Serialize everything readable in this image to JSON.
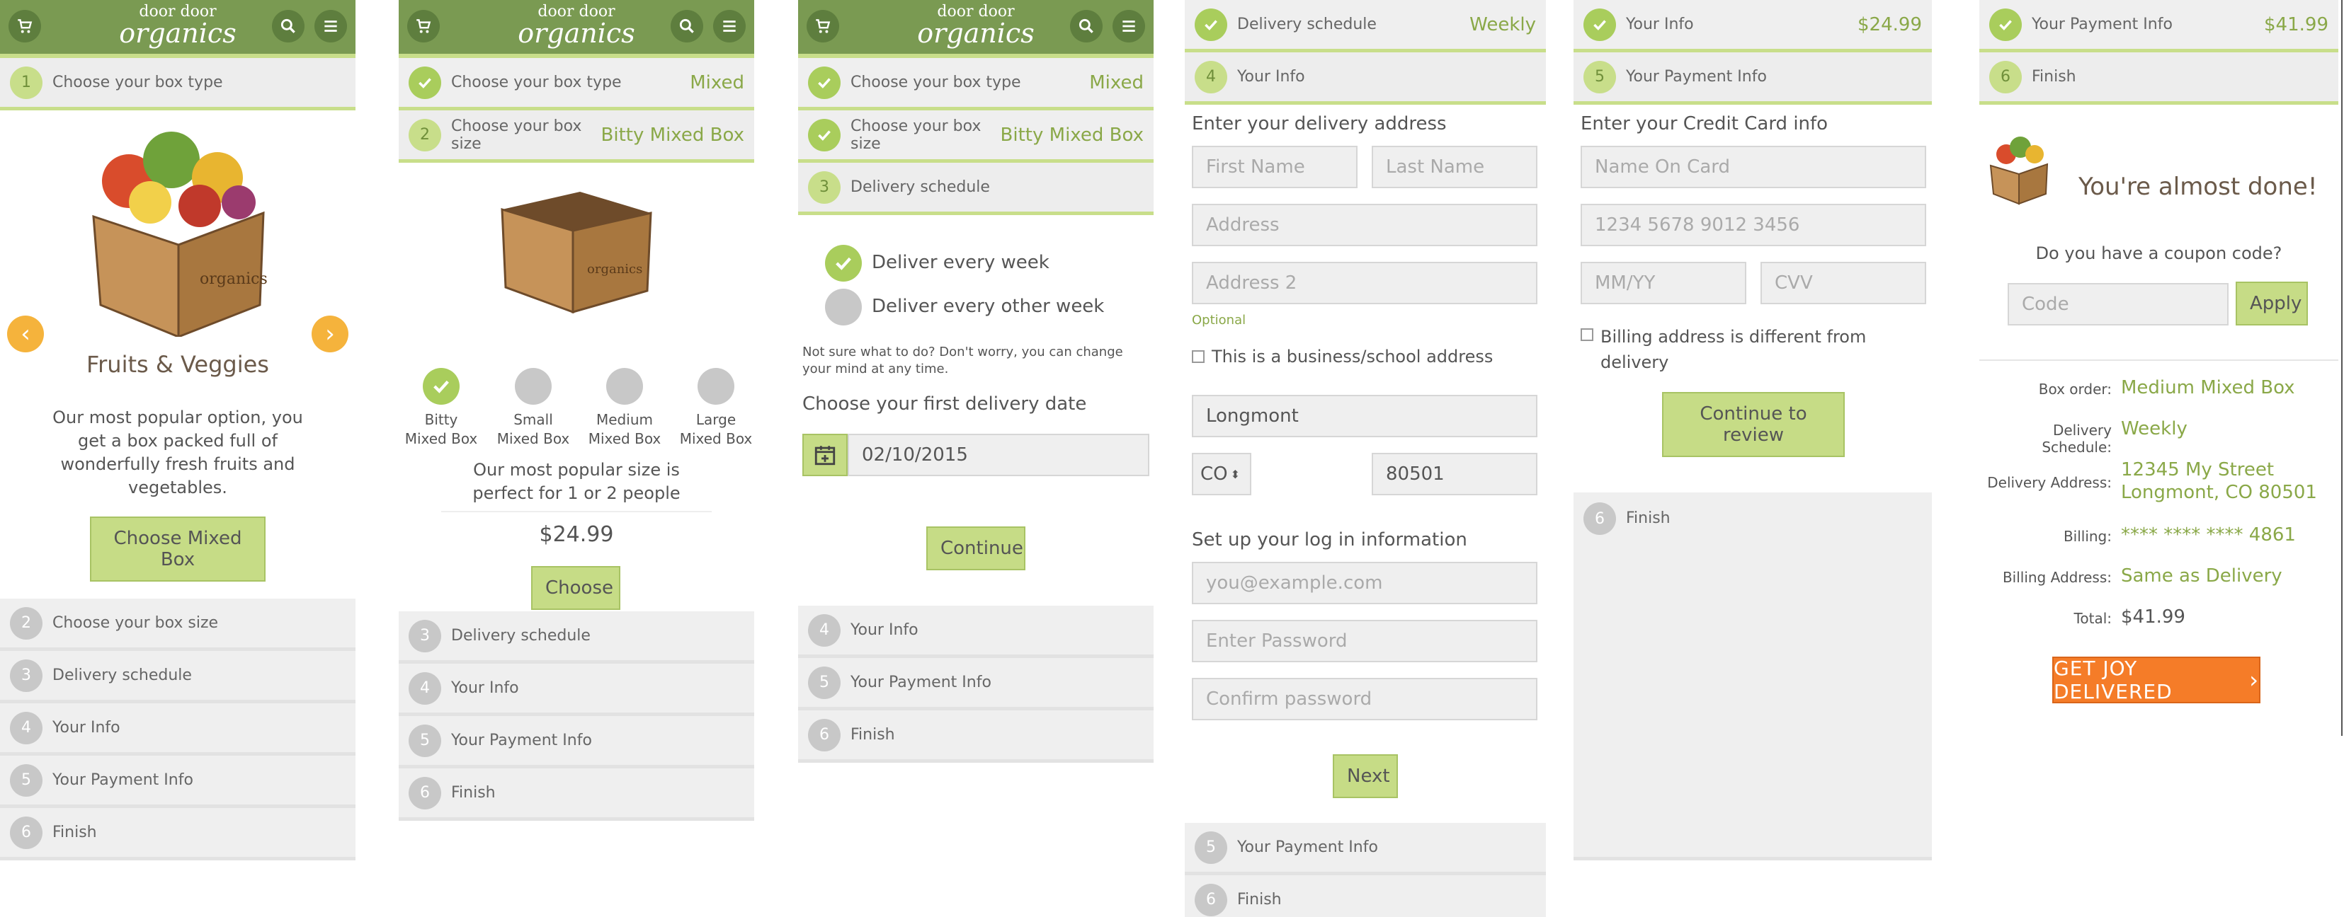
{
  "brand": {
    "line1": "door  door",
    "line2": "organics"
  },
  "colors": {
    "header": "#7a9a52",
    "accent": "#a9cd5c",
    "button": "#c6dc86",
    "orange": "#f57c28"
  },
  "steps": {
    "box_type": "Choose your box type",
    "box_size": "Choose your box size",
    "delivery": "Delivery schedule",
    "info": "Your Info",
    "payment": "Your Payment Info",
    "finish": "Finish"
  },
  "nums": {
    "n1": "1",
    "n2": "2",
    "n3": "3",
    "n4": "4",
    "n5": "5",
    "n6": "6"
  },
  "p1": {
    "title": "Fruits & Veggies",
    "desc": "Our most popular option, you get a box packed full of wonderfully fresh fruits and vegetables.",
    "button": "Choose Mixed Box"
  },
  "p2": {
    "type_value": "Mixed",
    "size_value": "Bitty Mixed Box",
    "sizes": [
      "Bitty Mixed Box",
      "Small Mixed Box",
      "Medium Mixed Box",
      "Large Mixed Box"
    ],
    "size_l1": [
      "Bitty",
      "Small",
      "Medium",
      "Large"
    ],
    "size_l2": "Mixed Box",
    "tag": "Our most popular size is perfect for 1 or 2 people",
    "price": "$24.99",
    "button": "Choose"
  },
  "p3": {
    "type_value": "Mixed",
    "size_value": "Bitty Mixed Box",
    "opt_week": "Deliver every week",
    "opt_other": "Deliver every other week",
    "note": "Not sure what to do? Don't worry, you can change your mind at any time.",
    "date_label": "Choose your first delivery date",
    "date_value": "02/10/2015",
    "button": "Continue"
  },
  "p4": {
    "delivery_value": "Weekly",
    "addr_heading": "Enter your delivery address",
    "first_name": "First Name",
    "last_name": "Last Name",
    "address": "Address",
    "address2": "Address 2",
    "optional": "Optional",
    "business": "This is a business/school address",
    "city": "Longmont",
    "state": "CO",
    "zip": "80501",
    "login_heading": "Set up your log in information",
    "email": "you@example.com",
    "password": "Enter Password",
    "confirm": "Confirm password",
    "button": "Next"
  },
  "p5": {
    "info_value": "$24.99",
    "cc_heading": "Enter your Credit Card info",
    "name_on_card": "Name On Card",
    "card_number": "1234 5678 9012 3456",
    "exp": "MM/YY",
    "cvv": "CVV",
    "billing_diff_1": "Billing address is different from",
    "billing_diff_2": "delivery",
    "button": "Continue to review"
  },
  "p6": {
    "payment_value": "$41.99",
    "almost": "You're almost done!",
    "coupon_q": "Do you have a coupon code?",
    "code": "Code",
    "apply": "Apply",
    "summary": {
      "box_order_k": "Box order:",
      "box_order_v": "Medium Mixed Box",
      "sched_k": "Delivery Schedule:",
      "sched_v": "Weekly",
      "addr_k": "Delivery Address:",
      "addr_v1": "12345 My Street",
      "addr_v2": "Longmont, CO 80501",
      "billing_k": "Billing:",
      "billing_v": "**** **** **** 4861",
      "baddr_k": "Billing Address:",
      "baddr_v": "Same as Delivery",
      "total_k": "Total:",
      "total_v": "$41.99"
    },
    "cta": "GET JOY DELIVERED"
  }
}
